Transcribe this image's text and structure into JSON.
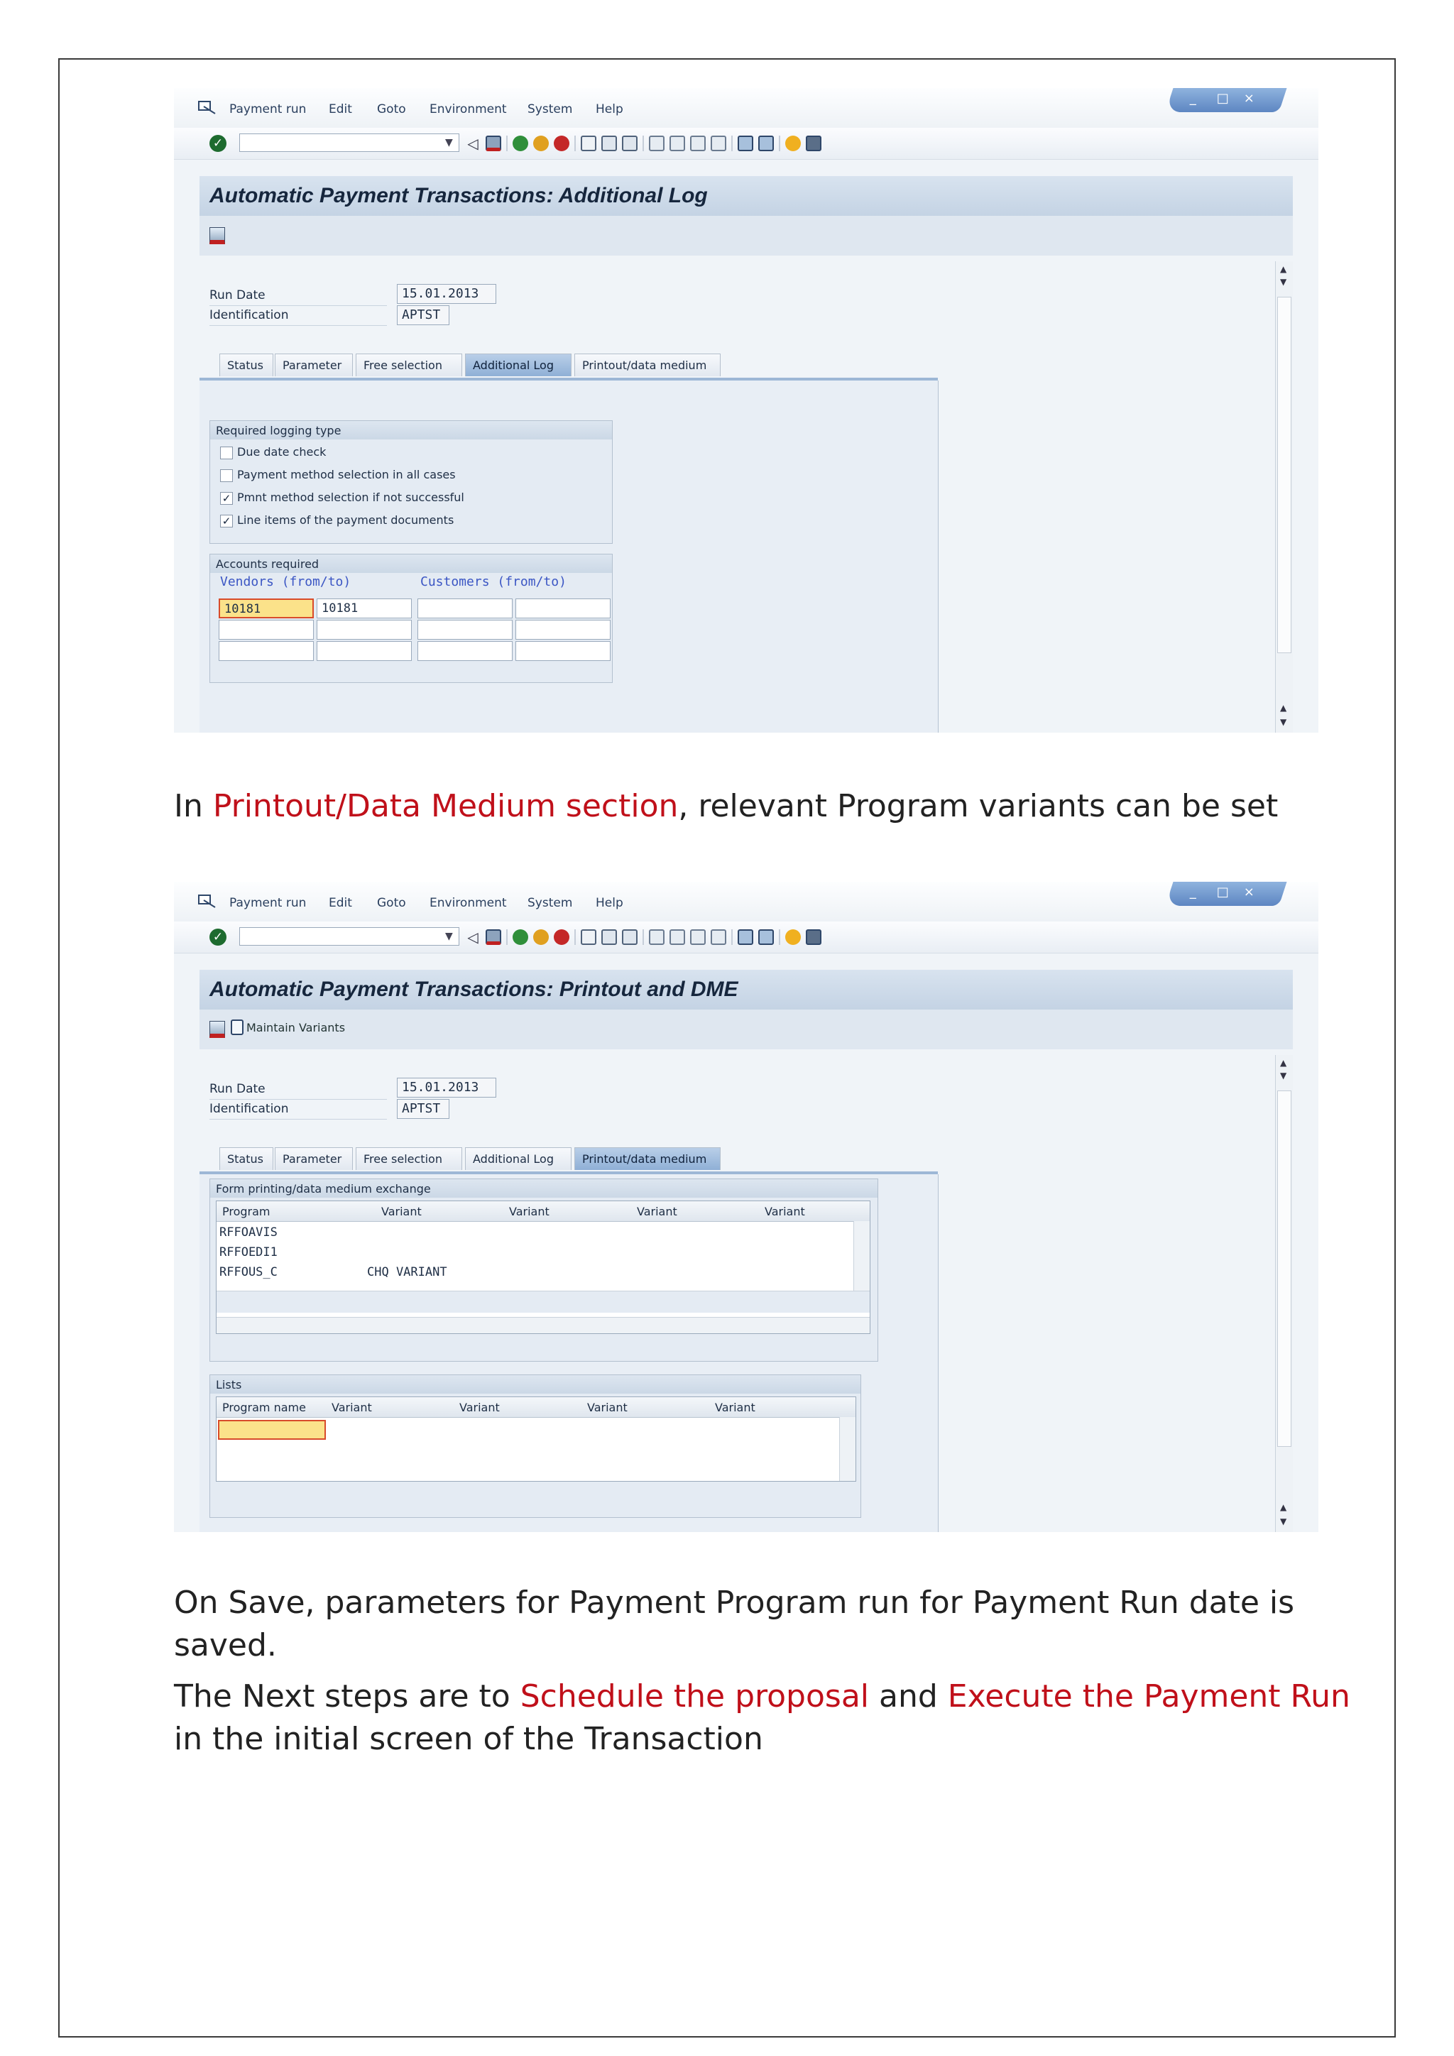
{
  "menu": [
    "Payment run",
    "Edit",
    "Goto",
    "Environment",
    "System",
    "Help"
  ],
  "window_controls": [
    "_",
    "□",
    "×"
  ],
  "screen1": {
    "title": "Automatic Payment Transactions: Additional Log",
    "run_date_label": "Run Date",
    "run_date": "15.01.2013",
    "identification_label": "Identification",
    "identification": "APTST",
    "tabs": [
      "Status",
      "Parameter",
      "Free selection",
      "Additional Log",
      "Printout/data medium"
    ],
    "active_tab": "Additional Log",
    "logging_group": {
      "title": "Required logging type",
      "items": [
        {
          "label": "Due date check",
          "checked": false
        },
        {
          "label": "Payment method selection in all cases",
          "checked": false
        },
        {
          "label": "Pmnt method selection if not successful",
          "checked": true
        },
        {
          "label": "Line items of the payment documents",
          "checked": true
        }
      ]
    },
    "accounts_group": {
      "title": "Accounts required",
      "vendors_header": "Vendors (from/to)",
      "customers_header": "Customers (from/to)",
      "vendor_from": "10181",
      "vendor_to": "10181"
    }
  },
  "para1": {
    "prefix": "In ",
    "highlight": "Printout/Data Medium section",
    "suffix": ", relevant Program variants can be set"
  },
  "screen2": {
    "title": "Automatic Payment Transactions: Printout and DME",
    "maintain_variants": "Maintain Variants",
    "run_date_label": "Run Date",
    "run_date": "15.01.2013",
    "identification_label": "Identification",
    "identification": "APTST",
    "tabs": [
      "Status",
      "Parameter",
      "Free selection",
      "Additional Log",
      "Printout/data medium"
    ],
    "active_tab": "Printout/data medium",
    "form_group": {
      "title": "Form printing/data medium exchange",
      "columns": [
        "Program",
        "Variant",
        "Variant",
        "Variant",
        "Variant"
      ],
      "rows": [
        {
          "program": "RFFOAVIS",
          "variant": ""
        },
        {
          "program": "RFFOEDI1",
          "variant": ""
        },
        {
          "program": "RFFOUS_C",
          "variant": "CHQ VARIANT"
        }
      ]
    },
    "lists_group": {
      "title": "Lists",
      "columns": [
        "Program name",
        "Variant",
        "Variant",
        "Variant",
        "Variant"
      ]
    }
  },
  "para2": "On Save, parameters for Payment Program run for Payment Run date is saved.",
  "para3": {
    "part1": "The Next steps are to ",
    "hl1": "Schedule the proposal",
    "part2": " and ",
    "hl2": "Execute the Payment Run",
    "part3": " in the initial screen of the Transaction"
  }
}
